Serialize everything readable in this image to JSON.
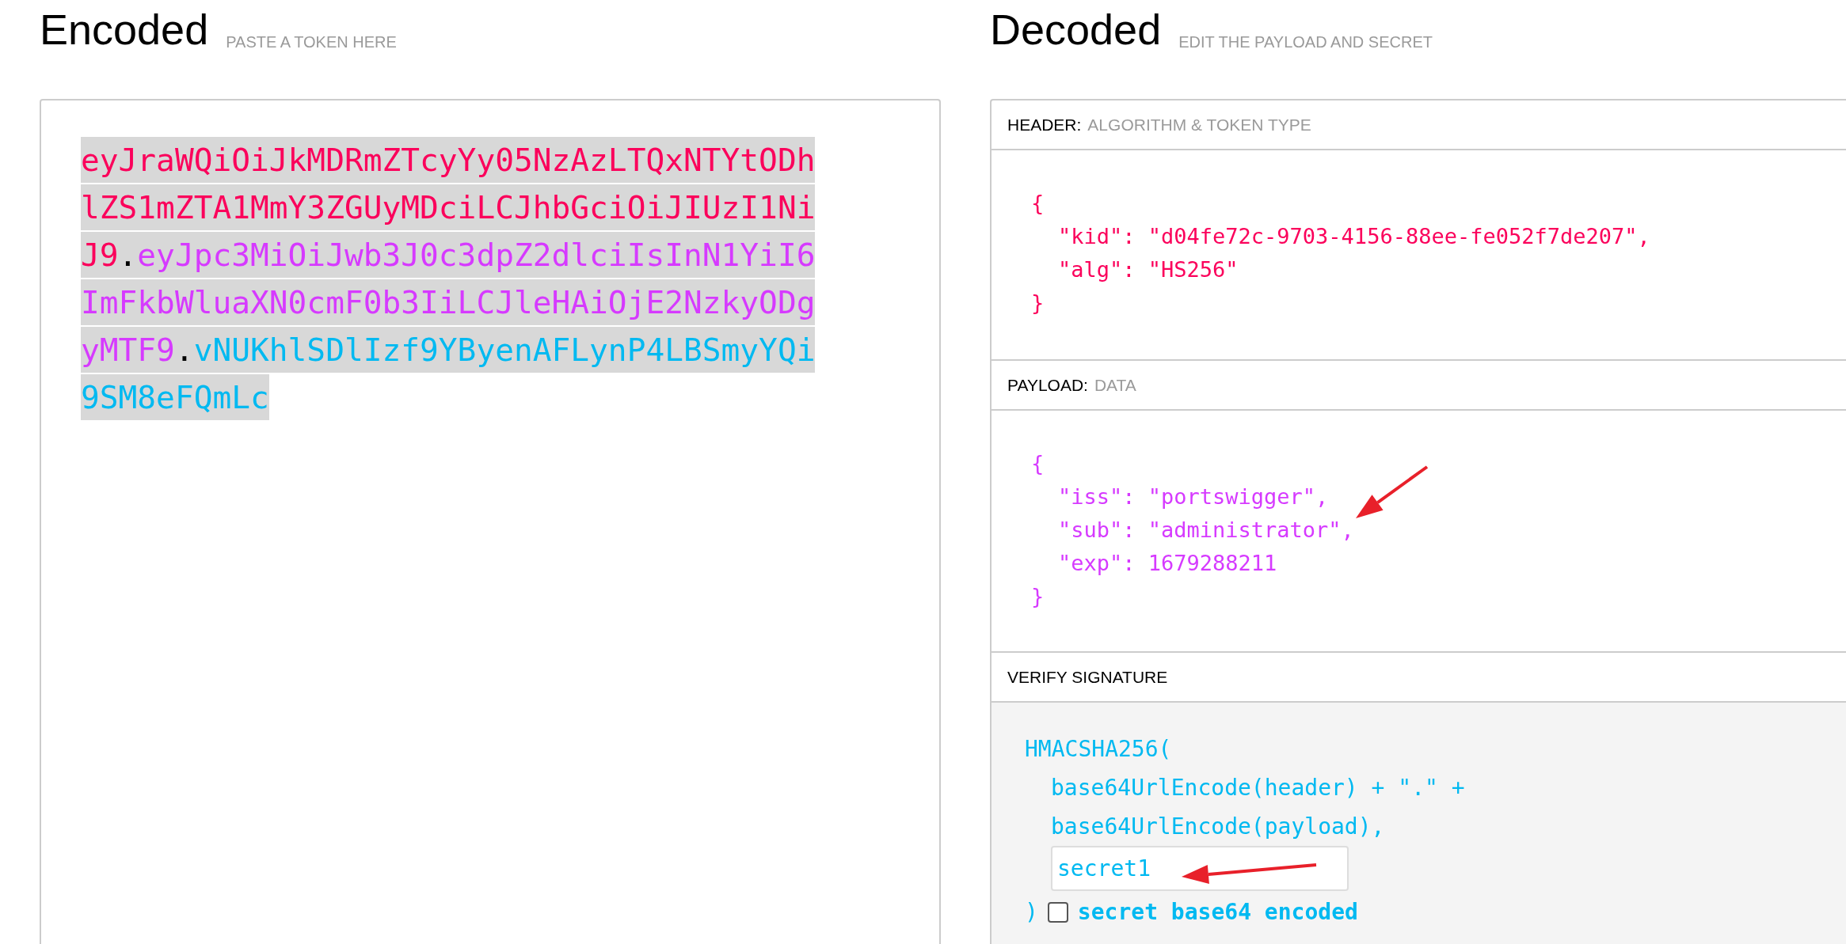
{
  "encoded": {
    "title": "Encoded",
    "subtitle": "PASTE A TOKEN HERE",
    "token": [
      {
        "kind": "header",
        "text": "eyJraWQiOiJkMDRmZTcyYy05NzAzLTQxNTYtODhlZS1mZTA1MmY3ZGUyMDciLCJhbGciOiJIUzI1NiJ9"
      },
      {
        "kind": "dot",
        "text": "."
      },
      {
        "kind": "payload",
        "text": "eyJpc3MiOiJwb3J0c3dpZ2dlciIsInN1YiI6ImFkbWluaXN0cmF0b3IiLCJleHAiOjE2NzkyODgyMTF9"
      },
      {
        "kind": "dot",
        "text": "."
      },
      {
        "kind": "signature",
        "text": "vNUKhlSDlIzf9YByenAFLynP4LBSmyYQi9SM8eFQmLc"
      }
    ]
  },
  "decoded": {
    "title": "Decoded",
    "subtitle": "EDIT THE PAYLOAD AND SECRET",
    "sections": [
      {
        "kind": "json",
        "label": "HEADER:",
        "sublabel": "ALGORITHM & TOKEN TYPE",
        "open": "{",
        "entries": [
          "\"kid\": \"d04fe72c-9703-4156-88ee-fe052f7de207\",",
          "\"alg\": \"HS256\""
        ],
        "close": "}"
      },
      {
        "kind": "json",
        "label": "PAYLOAD:",
        "sublabel": "DATA",
        "open": "{",
        "entries": [
          "\"iss\": \"portswigger\",",
          "\"sub\": \"administrator\",",
          "\"exp\": 1679288211"
        ],
        "close": "}"
      },
      {
        "kind": "verify",
        "label": "VERIFY SIGNATURE",
        "function": "HMACSHA256(",
        "args": [
          "base64UrlEncode(header) + \".\" +",
          "base64UrlEncode(payload),"
        ],
        "secret": "secret1",
        "close": ")",
        "base64_checked": false,
        "base64_label": "secret base64 encoded"
      }
    ]
  }
}
